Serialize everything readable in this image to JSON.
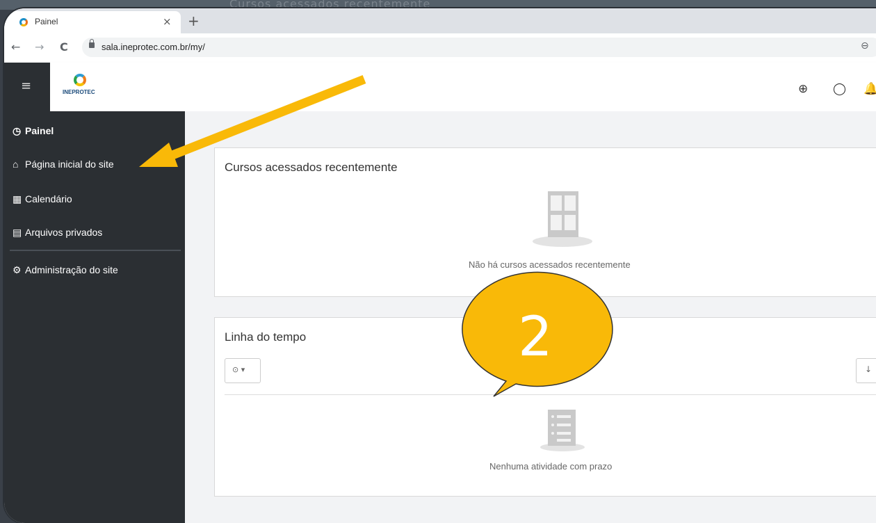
{
  "background": {
    "ghost_text": "Cursos acessados recentemente"
  },
  "browser": {
    "tab_title": "Painel",
    "tab_close": "×",
    "new_tab": "+",
    "back": "←",
    "forward": "→",
    "reload": "C",
    "url": "sala.ineprotec.com.br/my/",
    "zoom_icon": "⊖"
  },
  "header": {
    "menu_icon": "≡",
    "logo_text": "INEPROTEC",
    "language_icon": "⊕",
    "chat_icon": "◯",
    "bell_icon": "🔔"
  },
  "sidebar": {
    "items": [
      {
        "icon": "◷",
        "label": "Painel"
      },
      {
        "icon": "⌂",
        "label": "Página inicial do site"
      },
      {
        "icon": "▦",
        "label": "Calendário"
      },
      {
        "icon": "▤",
        "label": "Arquivos privados"
      },
      {
        "icon": "⚙",
        "label": "Administração do site"
      }
    ]
  },
  "main": {
    "recent_courses": {
      "title": "Cursos acessados recentemente",
      "empty_text": "Não há cursos acessados recentemente"
    },
    "timeline": {
      "title": "Linha do tempo",
      "filter_label": "⊙ ▾",
      "sort_label": "↓",
      "empty_text": "Nenhuma atividade com prazo"
    }
  },
  "annotation": {
    "step_number": "2",
    "arrow_color": "#f9b908",
    "bubble_color": "#f9b908"
  }
}
